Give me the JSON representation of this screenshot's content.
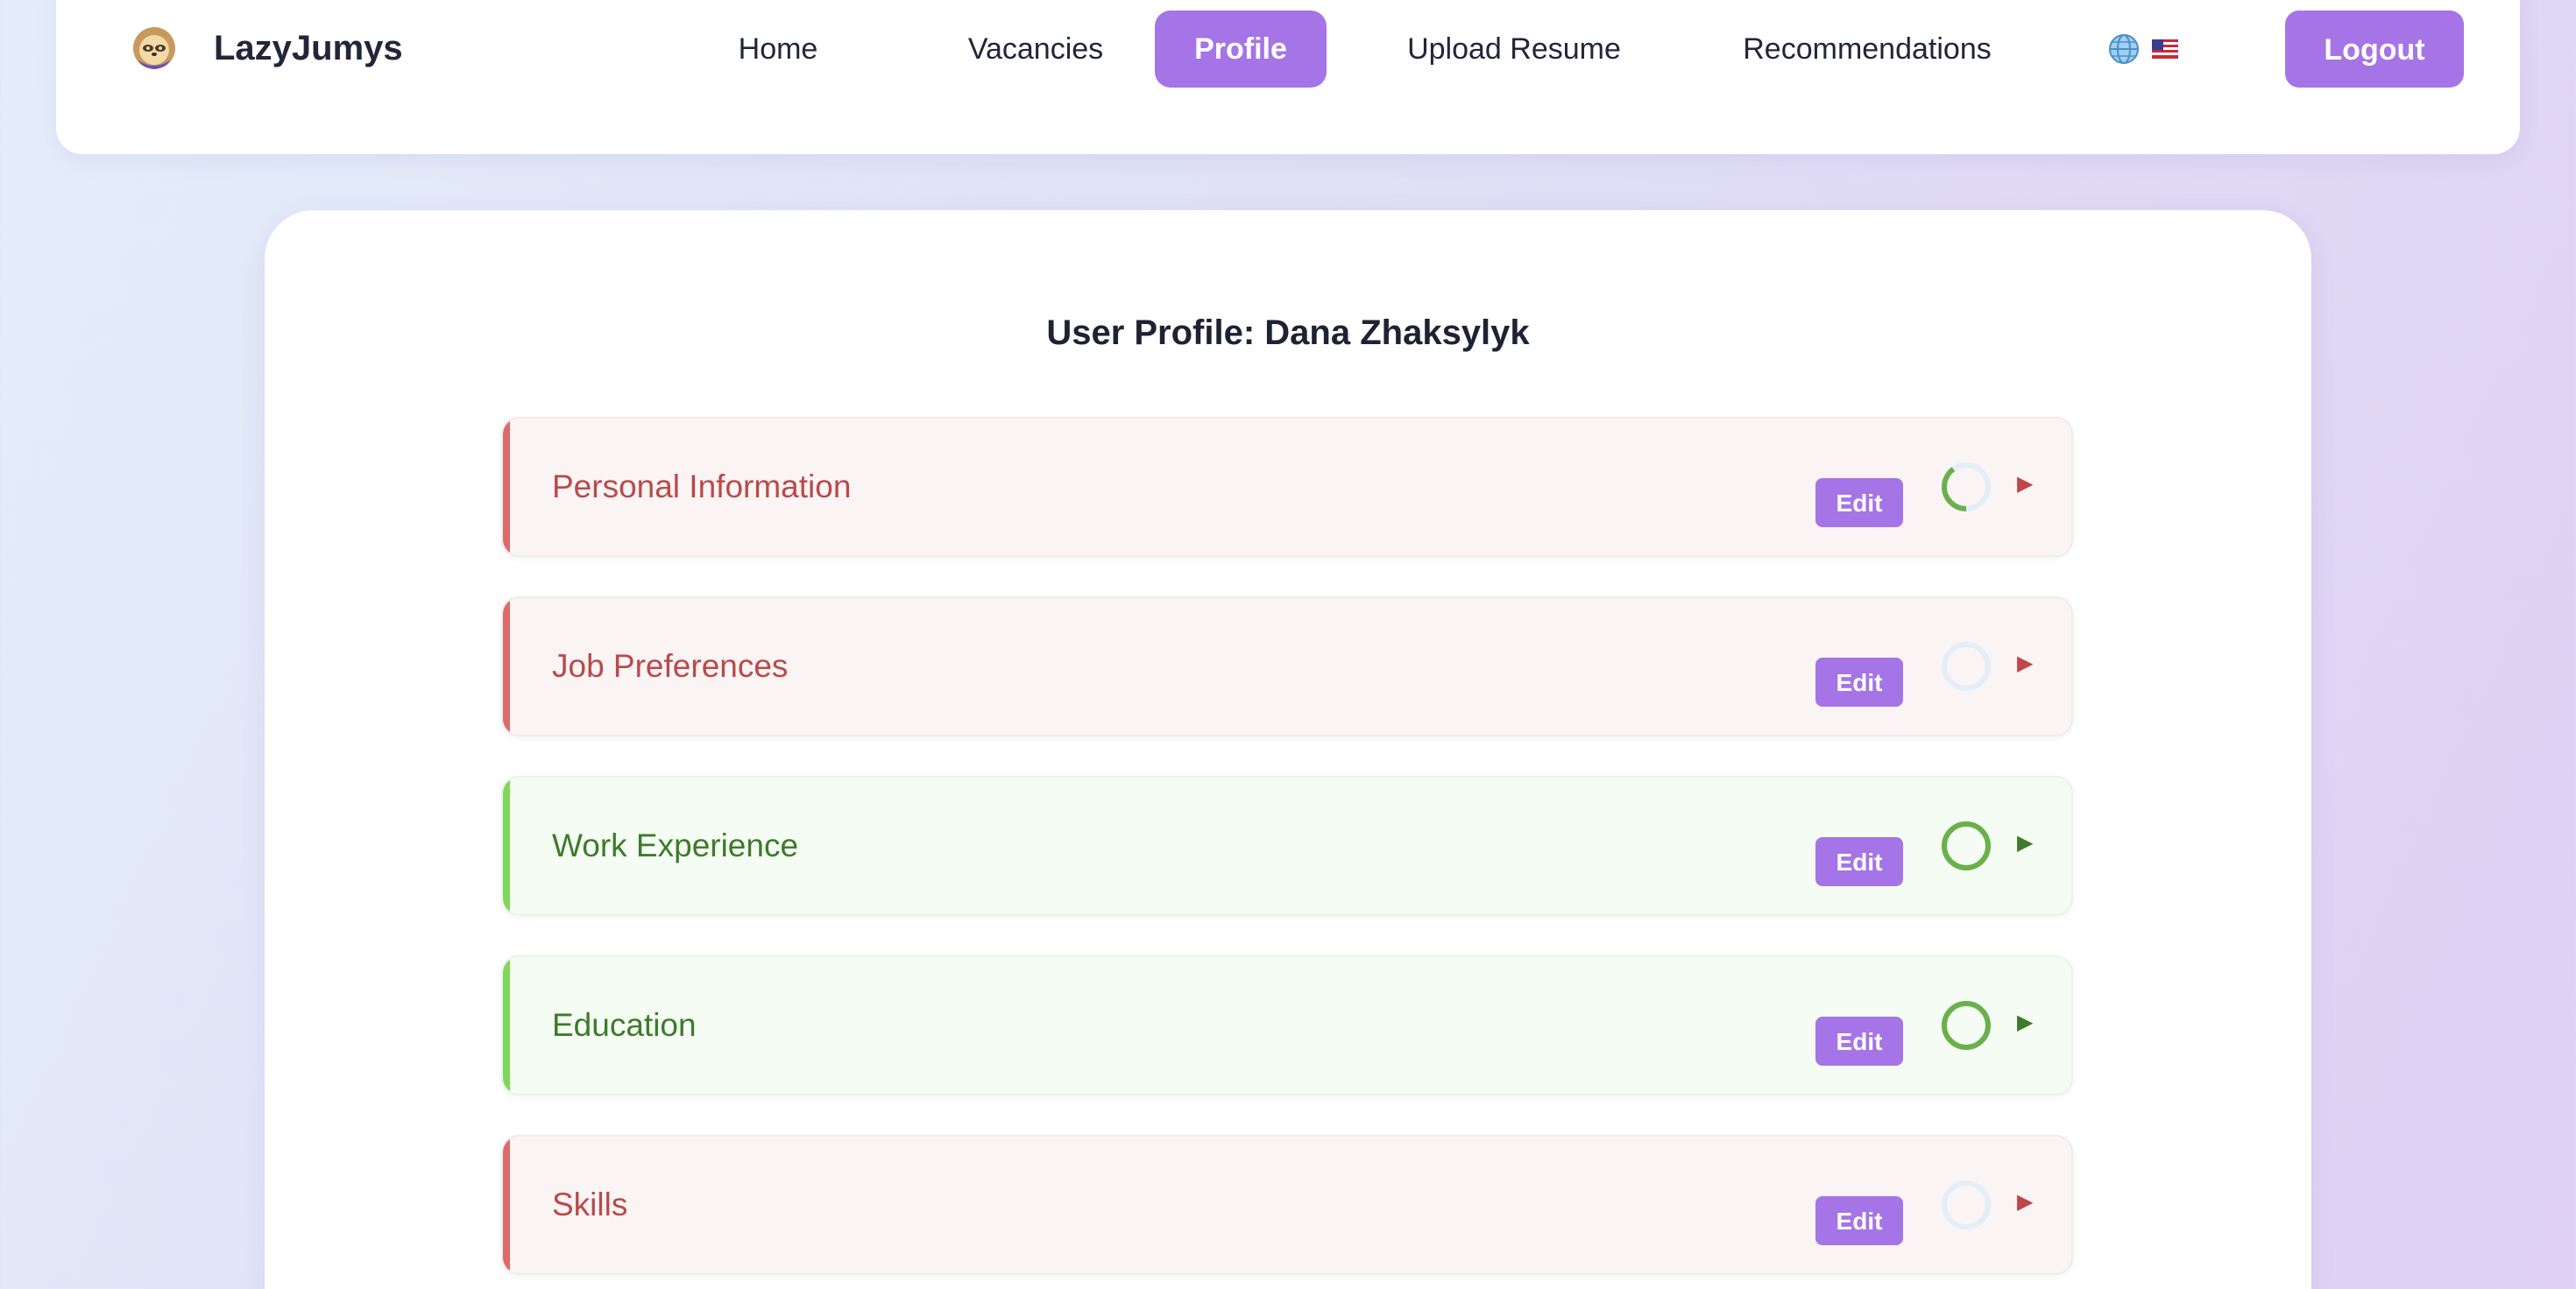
{
  "brand": {
    "name": "LazyJumys",
    "logo_icon": "sloth-logo-icon"
  },
  "nav": {
    "items": [
      {
        "label": "Home",
        "active": false
      },
      {
        "label": "Vacancies",
        "active": false
      },
      {
        "label": "Profile",
        "active": true
      },
      {
        "label": "Upload Resume",
        "active": false
      },
      {
        "label": "Recommendations",
        "active": false
      }
    ],
    "language_icons": [
      "globe-icon",
      "us-flag-icon"
    ],
    "logout_label": "Logout"
  },
  "colors": {
    "accent": "#a574e6",
    "incomplete": "#dc6a6a",
    "complete": "#7fd65a",
    "progress_ring": "#6ab04c",
    "progress_track": "#e4eef8"
  },
  "profile": {
    "title": "User Profile: Dana Zhaksylyk",
    "sections": [
      {
        "title": "Personal Information",
        "status": "incomplete",
        "edit_label": "Edit",
        "progress": 0.4
      },
      {
        "title": "Job Preferences",
        "status": "incomplete",
        "edit_label": "Edit",
        "progress": 0
      },
      {
        "title": "Work Experience",
        "status": "complete",
        "edit_label": "Edit",
        "progress": 1
      },
      {
        "title": "Education",
        "status": "complete",
        "edit_label": "Edit",
        "progress": 1
      },
      {
        "title": "Skills",
        "status": "incomplete",
        "edit_label": "Edit",
        "progress": 0
      }
    ]
  }
}
